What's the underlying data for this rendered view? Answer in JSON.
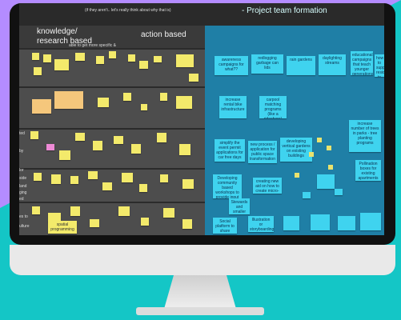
{
  "colors": {
    "background": "#14c6c6",
    "accent": "#b48cff",
    "left_board": "#3a3a3a",
    "right_board": "#1f7fa6"
  },
  "board": {
    "top_left_label": "",
    "top_note": "(if they aren't.. let's really think about why that is)",
    "top_right_label": "- Project team formation",
    "left_header_1": "knowledge/ research based",
    "left_header_2": "action based",
    "left_subnote": "able to get more specific & demonstrate connection to adaptation",
    "lane_labels": [
      "ted",
      "by",
      "lor",
      "side",
      "land",
      "ging",
      "ed",
      "es to",
      "ulture"
    ]
  },
  "stickies": [
    "awareness campaigns for what??",
    "redlogging garbage can lids",
    "rain gardens",
    "daylighting streams",
    "educational campaigns that teach younger generations about waste",
    "how to support residents to identify invasive species",
    "increase rental bike infrastructure",
    "carpool matching programs (like a rideshare)",
    "simplify the event permit applications for car free days",
    "new process / application for public space transformation",
    "developing vertical gardens on existing buildings",
    "increase number of trees in parks - tree planting programs",
    "Pollination boxes for existing apartments",
    "Developing community based workshops to provide input",
    "creating new aid on how to create micro-climates",
    "Stewards and smaller cultivation?",
    "Social platform to share climate stories",
    "Illustration or storyboarding design",
    "spatial programming"
  ]
}
